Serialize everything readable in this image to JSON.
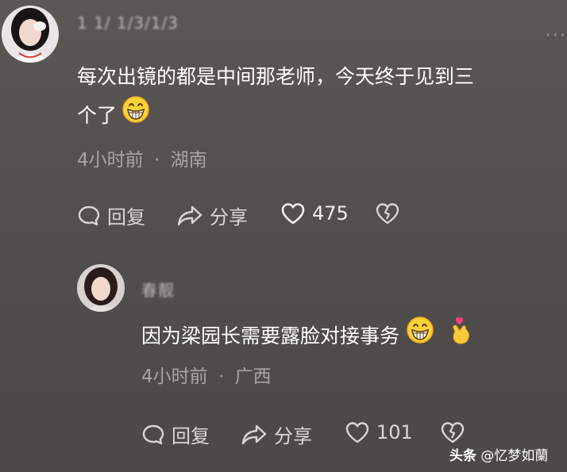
{
  "comment": {
    "username": "1 1/ 1/3/1/3",
    "text_line1": "每次出镜的都是中间那老师，今天终于见到三",
    "text_line2": "个了",
    "emoji": "grinning-face",
    "time": "4小时前",
    "location": "湖南",
    "reply_label": "回复",
    "share_label": "分享",
    "like_count": "475"
  },
  "reply": {
    "username": "春靓",
    "text": "因为梁园长需要露脸对接事务",
    "emojis": [
      "grinning-face",
      "finger-heart"
    ],
    "time": "4小时前",
    "location": "广西",
    "reply_label": "回复",
    "share_label": "分享",
    "like_count": "101"
  },
  "meta_separator": "·",
  "watermark": {
    "platform": "头条",
    "author": "@忆梦如蘭"
  },
  "colors": {
    "background": "#55524f",
    "text_primary": "#ffffff",
    "text_secondary": "#a7a4a1",
    "finger_heart_pink": "#ff3f7f",
    "emoji_yellow": "#ffd23a"
  }
}
